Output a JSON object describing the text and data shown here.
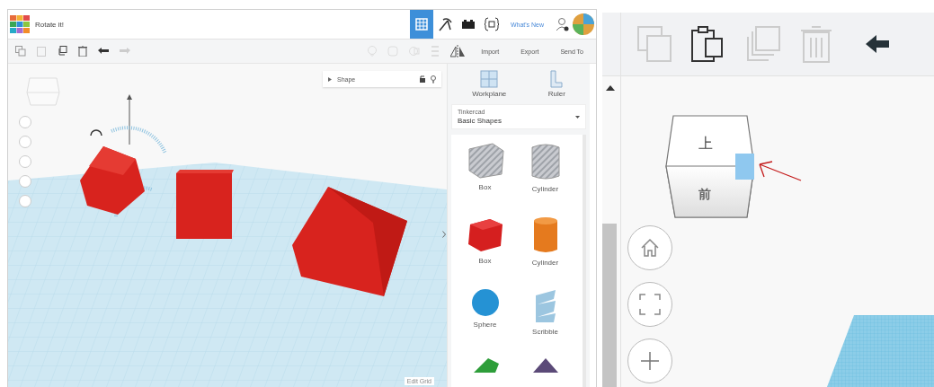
{
  "left_window": {
    "title": "Rotate it!",
    "header_link": "What's New",
    "toolbar_buttons": [
      "Import",
      "Export",
      "Send To"
    ],
    "inspector": {
      "title": "Shape"
    },
    "viewport": {
      "grid_label": "Edit Grid"
    },
    "sidebar": {
      "tools": [
        {
          "kind": "workplane",
          "label": "Workplane"
        },
        {
          "kind": "ruler",
          "label": "Ruler"
        }
      ],
      "library": {
        "label": "Tinkercad",
        "value": "Basic Shapes"
      },
      "shapes": [
        {
          "kind": "box-hole",
          "label": "Box"
        },
        {
          "kind": "cylinder-hole",
          "label": "Cylinder"
        },
        {
          "kind": "box",
          "label": "Box"
        },
        {
          "kind": "cylinder",
          "label": "Cylinder"
        },
        {
          "kind": "sphere",
          "label": "Sphere"
        },
        {
          "kind": "scribble",
          "label": "Scribble"
        },
        {
          "kind": "roof"
        },
        {
          "kind": "pyramid"
        }
      ]
    }
  },
  "right_window": {
    "view_cube": {
      "top": "上",
      "front": "前"
    }
  }
}
